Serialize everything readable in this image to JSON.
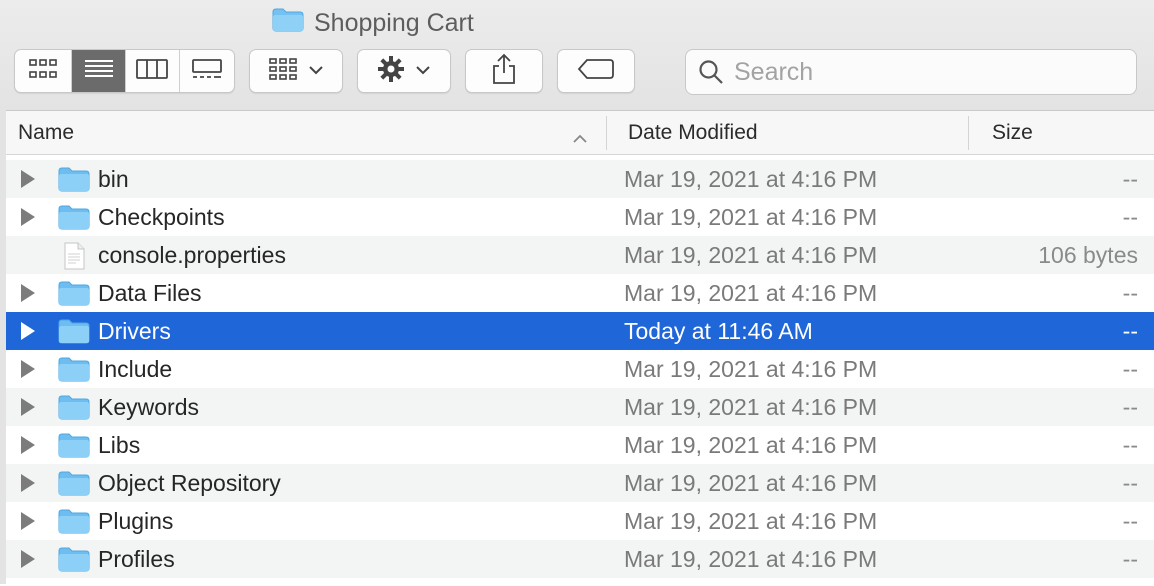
{
  "window": {
    "title": "Shopping Cart",
    "title_icon": "folder-icon"
  },
  "toolbar": {
    "view_modes": [
      {
        "name": "icon-view",
        "icon": "grid-icon",
        "active": false
      },
      {
        "name": "list-view",
        "icon": "list-icon",
        "active": true
      },
      {
        "name": "column-view",
        "icon": "columns-icon",
        "active": false
      },
      {
        "name": "gallery-view",
        "icon": "gallery-icon",
        "active": false
      }
    ],
    "group_icon": "grid-dropdown-icon",
    "action_icon": "gear-icon",
    "share_icon": "share-icon",
    "tag_icon": "tag-icon",
    "search_placeholder": "Search"
  },
  "columns": {
    "name": "Name",
    "date": "Date Modified",
    "size": "Size",
    "sort_indicator": "chevron-up-icon"
  },
  "files": [
    {
      "name": "bin",
      "date": "Mar 19, 2021 at 4:16 PM",
      "size": "--",
      "kind": "folder"
    },
    {
      "name": "Checkpoints",
      "date": "Mar 19, 2021 at 4:16 PM",
      "size": "--",
      "kind": "folder"
    },
    {
      "name": "console.properties",
      "date": "Mar 19, 2021 at 4:16 PM",
      "size": "106 bytes",
      "kind": "file"
    },
    {
      "name": "Data Files",
      "date": "Mar 19, 2021 at 4:16 PM",
      "size": "--",
      "kind": "folder"
    },
    {
      "name": "Drivers",
      "date": "Today at 11:46 AM",
      "size": "--",
      "kind": "folder",
      "selected": true
    },
    {
      "name": "Include",
      "date": "Mar 19, 2021 at 4:16 PM",
      "size": "--",
      "kind": "folder"
    },
    {
      "name": "Keywords",
      "date": "Mar 19, 2021 at 4:16 PM",
      "size": "--",
      "kind": "folder"
    },
    {
      "name": "Libs",
      "date": "Mar 19, 2021 at 4:16 PM",
      "size": "--",
      "kind": "folder"
    },
    {
      "name": "Object Repository",
      "date": "Mar 19, 2021 at 4:16 PM",
      "size": "--",
      "kind": "folder"
    },
    {
      "name": "Plugins",
      "date": "Mar 19, 2021 at 4:16 PM",
      "size": "--",
      "kind": "folder"
    },
    {
      "name": "Profiles",
      "date": "Mar 19, 2021 at 4:16 PM",
      "size": "--",
      "kind": "folder"
    }
  ],
  "colors": {
    "selection": "#1f66d8",
    "folder": "#5fb6ee"
  }
}
